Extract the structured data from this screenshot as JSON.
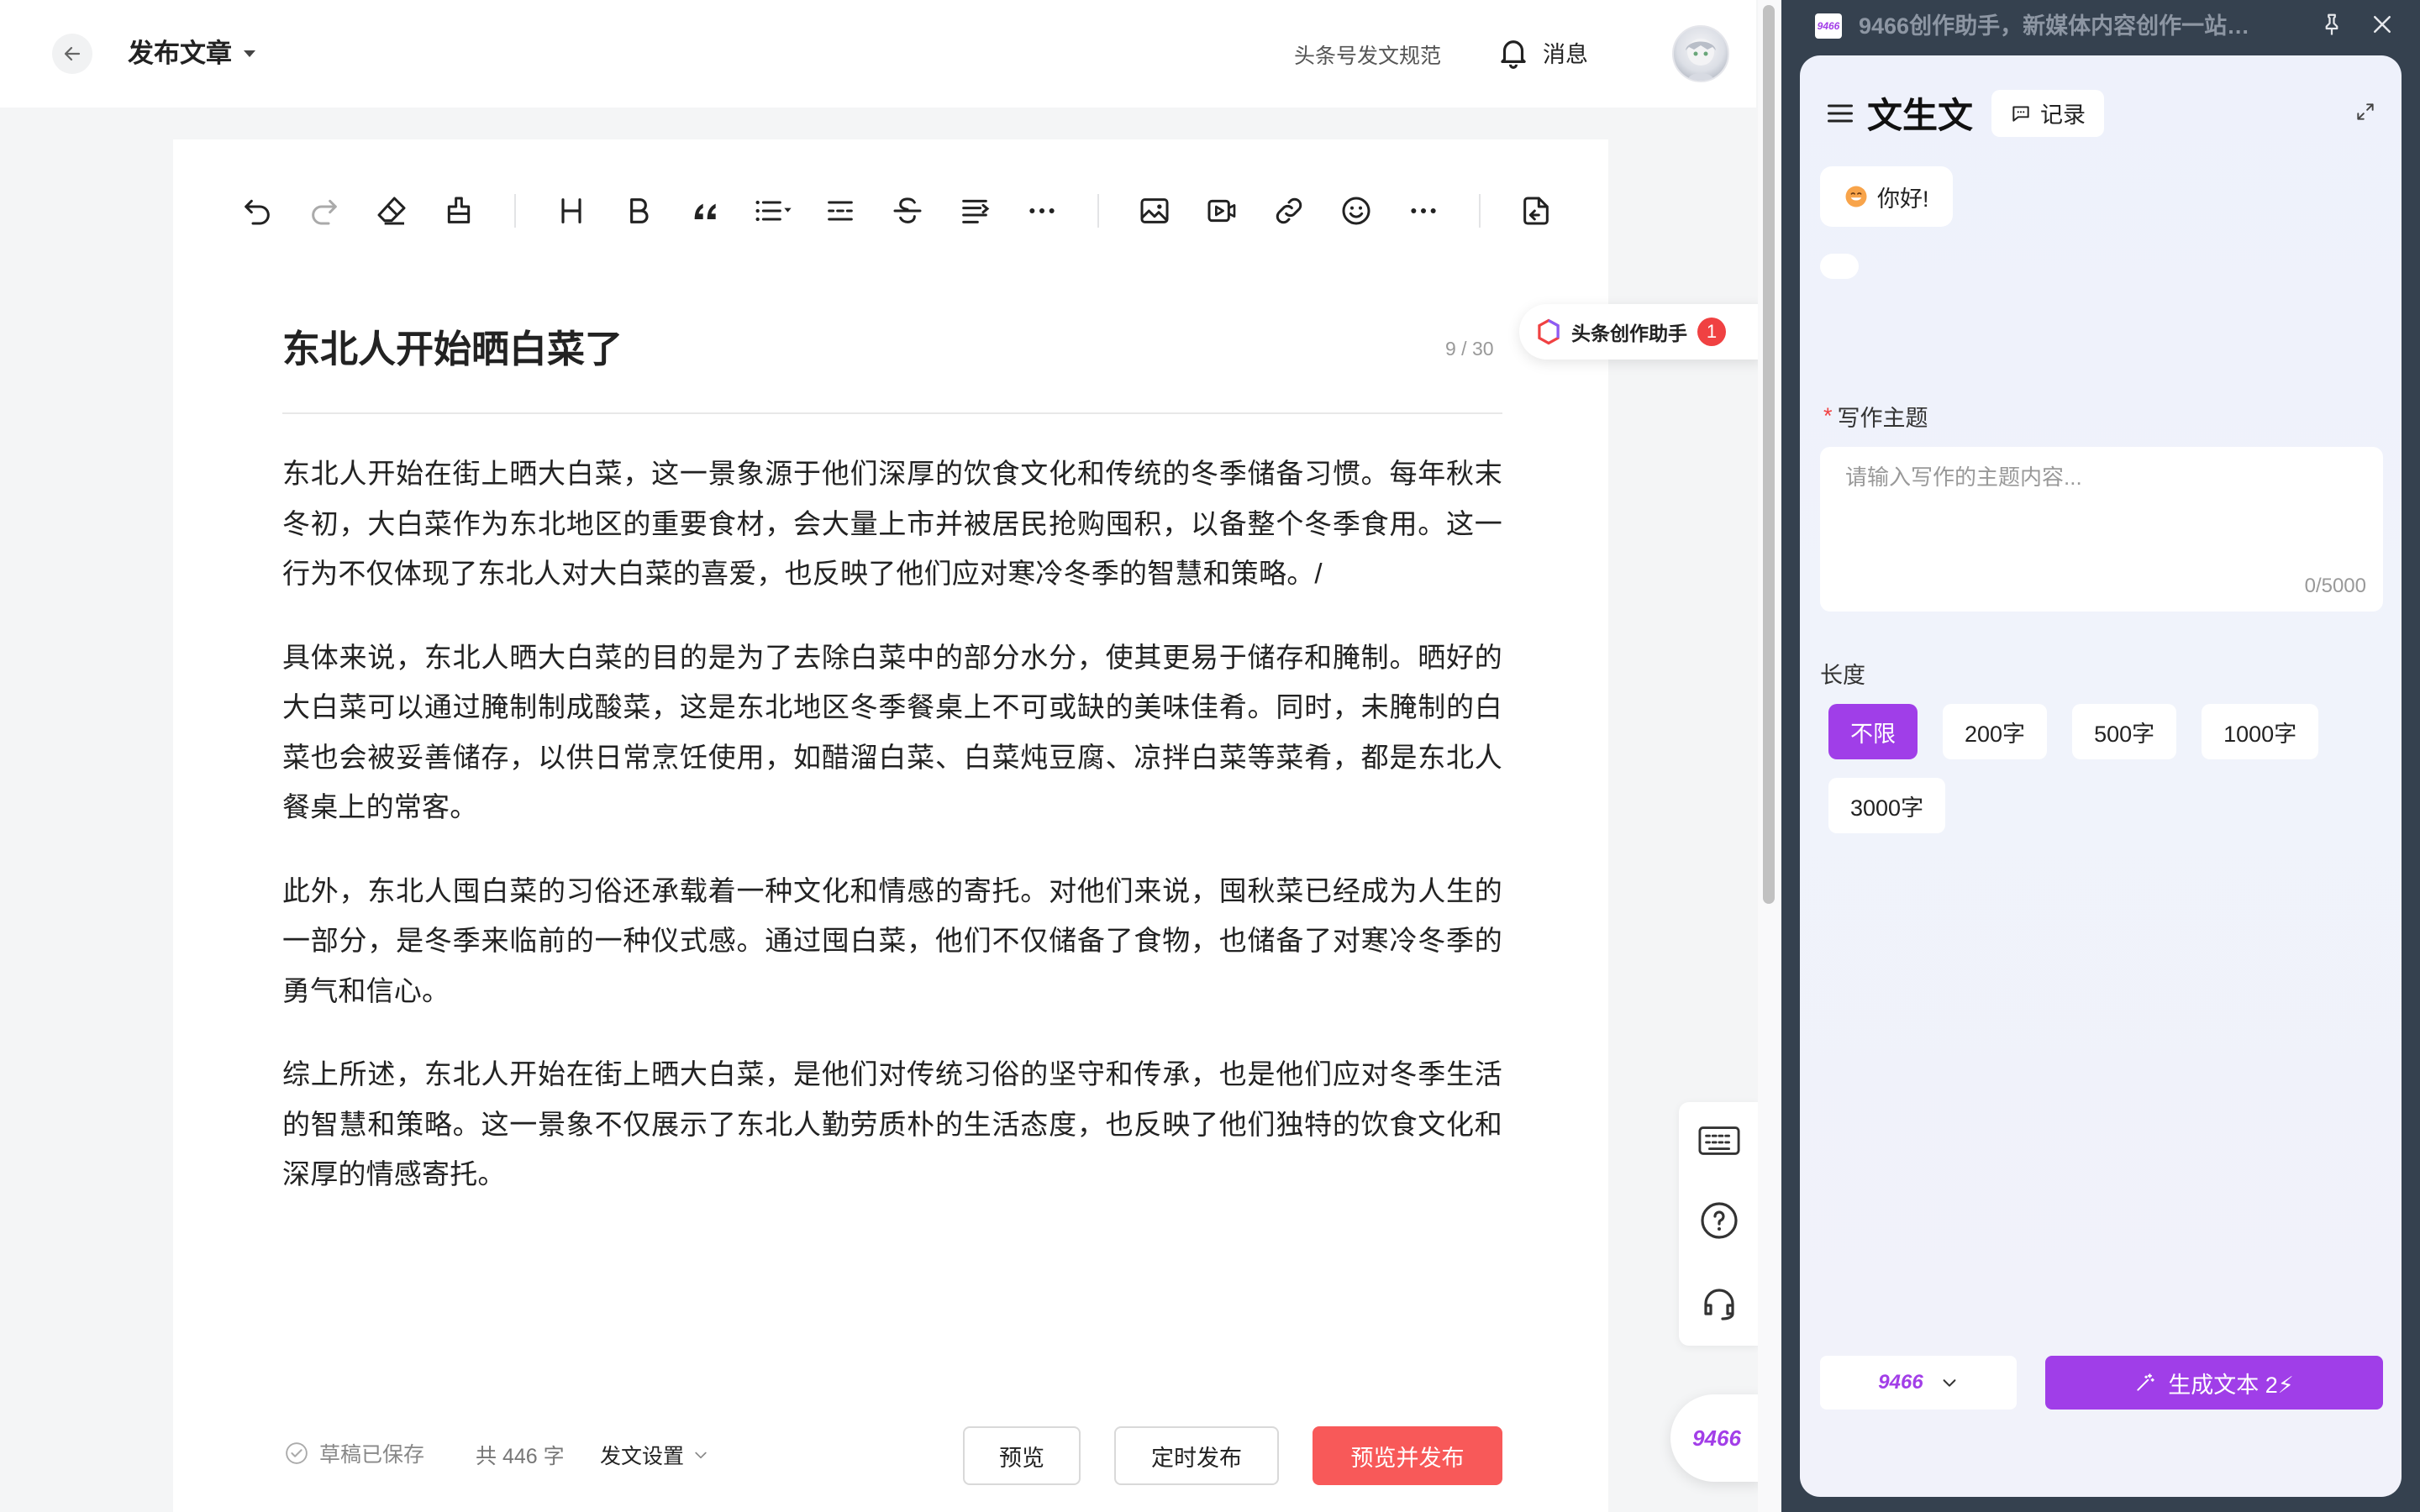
{
  "header": {
    "page_title": "发布文章",
    "guidelines_link": "头条号发文规范",
    "messages_label": "消息"
  },
  "editor": {
    "article_title": "东北人开始晒白菜了",
    "title_count": "9 / 30",
    "paragraphs": [
      "东北人开始在街上晒大白菜，这一景象源于他们深厚的饮食文化和传统的冬季储备习惯。每年秋末冬初，大白菜作为东北地区的重要食材，会大量上市并被居民抢购囤积，以备整个冬季食用。这一行为不仅体现了东北人对大白菜的喜爱，也反映了他们应对寒冷冬季的智慧和策略。/",
      "具体来说，东北人晒大白菜的目的是为了去除白菜中的部分水分，使其更易于储存和腌制。晒好的大白菜可以通过腌制制成酸菜，这是东北地区冬季餐桌上不可或缺的美味佳肴。同时，未腌制的白菜也会被妥善储存，以供日常烹饪使用，如醋溜白菜、白菜炖豆腐、凉拌白菜等菜肴，都是东北人餐桌上的常客。",
      "此外，东北人囤白菜的习俗还承载着一种文化和情感的寄托。对他们来说，囤秋菜已经成为人生的一部分，是冬季来临前的一种仪式感。通过囤白菜，他们不仅储备了食物，也储备了对寒冷冬季的勇气和信心。",
      "综上所述，东北人开始在街上晒大白菜，是他们对传统习俗的坚守和传承，也是他们应对冬季生活的智慧和策略。这一景象不仅展示了东北人勤劳质朴的生活态度，也反映了他们独特的饮食文化和深厚的情感寄托。"
    ],
    "assistant_chip_label": "头条创作助手",
    "assistant_badge": "1",
    "float_button_label": "9466"
  },
  "toolbar_icons": [
    "undo-icon",
    "redo-icon",
    "eraser-icon",
    "format-painter-icon",
    "heading-icon",
    "bold-icon",
    "quote-icon",
    "list-icon",
    "divider-icon",
    "strikethrough-icon",
    "indent-icon",
    "more-icon",
    "image-icon",
    "video-icon",
    "link-icon",
    "emoji-icon",
    "more-icon",
    "import-icon"
  ],
  "footer": {
    "draft_status": "草稿已保存",
    "word_count": "共 446 字",
    "post_settings": "发文设置",
    "preview_label": "预览",
    "schedule_label": "定时发布",
    "publish_label": "预览并发布"
  },
  "panel": {
    "window_title": "9466创作助手，新媒体内容创作一站式...",
    "app_icon_text": "9466",
    "mode_title": "文生文",
    "history_label": "记录",
    "greeting": "你好!",
    "topic_label": "写作主题",
    "topic_required_mark": "*",
    "topic_placeholder": "请输入写作的主题内容...",
    "topic_count": "0/5000",
    "length_label": "长度",
    "length_options": [
      "不限",
      "200字",
      "500字",
      "1000字",
      "3000字"
    ],
    "length_selected": "不限",
    "model_label": "9466",
    "generate_label": "生成文本 2⚡"
  },
  "colors": {
    "accent_purple": "#a03ee8",
    "publish_red": "#f85959",
    "badge_red": "#f04142",
    "panel_frame": "#35414f"
  }
}
